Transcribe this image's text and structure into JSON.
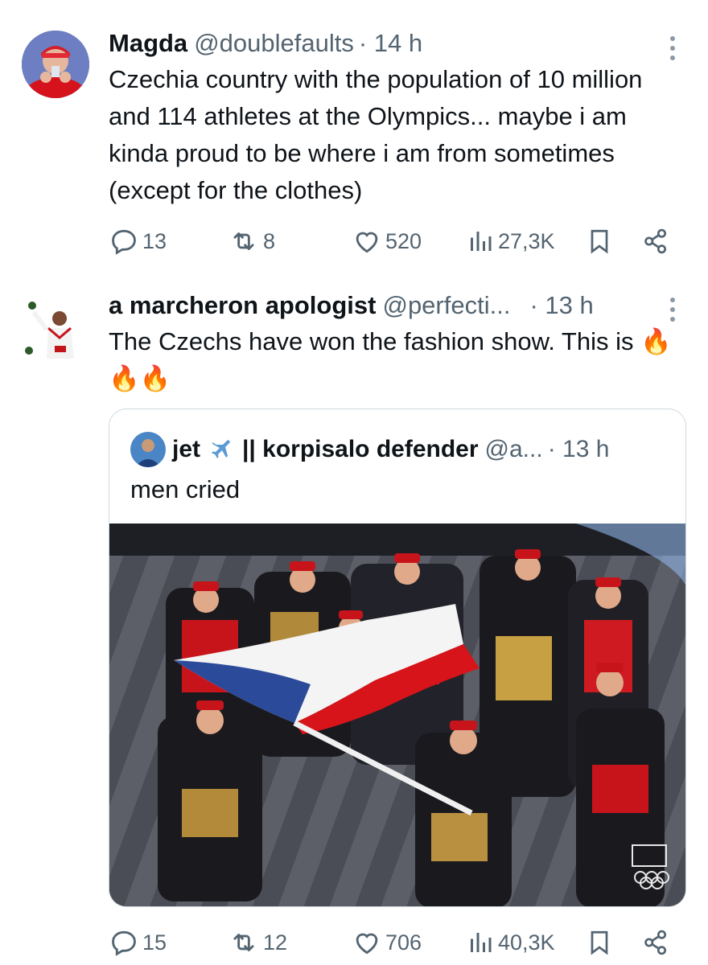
{
  "tweets": [
    {
      "name": "Magda",
      "handle": "@doublefaults",
      "time": "· 14 h",
      "text": "Czechia country with the population of 10 million and 114 athletes at the Olympics... maybe i am kinda proud to be where i am from sometimes (except for the clothes)",
      "replies": "13",
      "reposts": "8",
      "likes": "520",
      "views": "27,3K"
    },
    {
      "name": "a marcheron apologist",
      "handle": "@perfecti...",
      "time": "· 13 h",
      "text": "The Czechs have won the fashion show. This is",
      "emoji": "🔥🔥🔥",
      "quote": {
        "name": "jet",
        "name_suffix": "|| korpisalo defender",
        "handle": "@a...",
        "time": "· 13 h",
        "text": "men cried",
        "flag_colors": {
          "white": "#f4f4f4",
          "blue": "#2b4a9a",
          "red": "#d7141a"
        }
      },
      "replies": "15",
      "reposts": "12",
      "likes": "706",
      "views": "40,3K"
    }
  ],
  "icons": {
    "more": "more-vertical-icon",
    "reply": "reply-icon",
    "repost": "repost-icon",
    "like": "heart-icon",
    "views": "views-chart-icon",
    "bookmark": "bookmark-icon",
    "share": "share-icon",
    "plane": "airplane-icon"
  },
  "colors": {
    "text": "#0f1419",
    "muted": "#536471",
    "border": "#cfd9de"
  }
}
